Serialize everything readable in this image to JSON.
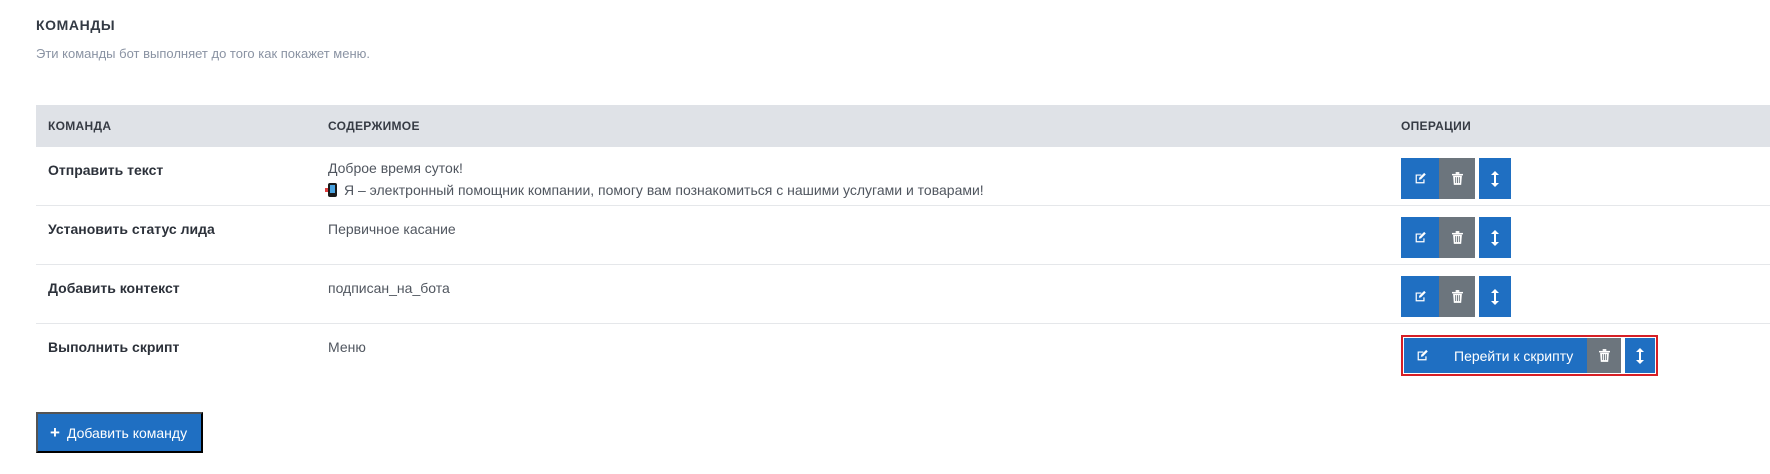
{
  "section": {
    "title": "КОМАНДЫ",
    "description": "Эти команды бот выполняет до того как покажет меню."
  },
  "table": {
    "headers": {
      "command": "КОМАНДА",
      "content": "СОДЕРЖИМОЕ",
      "operations": "ОПЕРАЦИИ"
    },
    "rows": [
      {
        "command": "Отправить текст",
        "content_line1": "Доброе время суток!",
        "content_line2": "Я – электронный помощник компании, помогу вам познакомиться с нашими услугами и товарами!"
      },
      {
        "command": "Установить статус лида",
        "content_line1": "Первичное касание"
      },
      {
        "command": "Добавить контекст",
        "content_line1": "подписан_на_бота"
      },
      {
        "command": "Выполнить скрипт",
        "content_line1": "Меню",
        "goto_label": "Перейти к скрипту"
      }
    ]
  },
  "add_button": {
    "label": "Добавить команду",
    "icon": "plus-icon"
  },
  "colors": {
    "primary": "#1f6fc2",
    "secondary": "#6c757d",
    "highlight": "#d61f26",
    "header_bg": "#dfe2e7"
  }
}
